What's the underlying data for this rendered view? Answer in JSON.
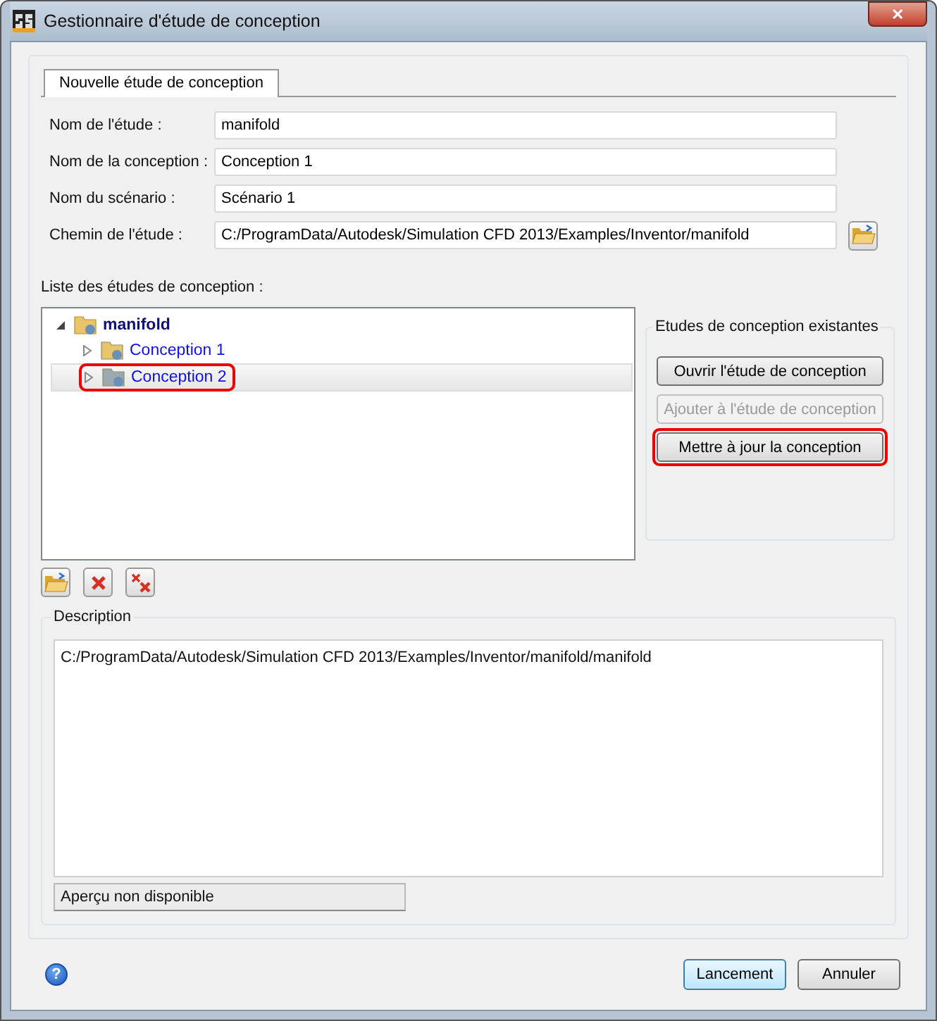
{
  "window": {
    "title": "Gestionnaire d'étude de conception",
    "close": "✕"
  },
  "tabs": [
    {
      "label": "Nouvelle étude de conception",
      "selected": true
    }
  ],
  "fields": [
    {
      "label": "Nom de l'étude :",
      "value": "manifold"
    },
    {
      "label": "Nom de la conception :",
      "value": "Conception 1"
    },
    {
      "label": "Nom du scénario :",
      "value": "Scénario 1"
    },
    {
      "label": "Chemin de l'étude :",
      "value": "C:/ProgramData/Autodesk/Simulation CFD 2013/Examples/Inventor/manifold",
      "browse": true
    }
  ],
  "tree": {
    "label": "Liste des études de conception :",
    "items": [
      {
        "label": "manifold",
        "expanded": true,
        "selected": false,
        "highlighted": false,
        "children": [
          {
            "label": "Conception 1",
            "expanded": false,
            "selected": false,
            "highlighted": false
          },
          {
            "label": "Conception 2",
            "expanded": false,
            "selected": true,
            "highlighted": true
          }
        ]
      }
    ]
  },
  "existing": {
    "title": "Etudes de conception existantes",
    "buttons": [
      {
        "label": "Ouvrir l'étude de conception",
        "disabled": false,
        "highlighted": false
      },
      {
        "label": "Ajouter à l'étude de conception",
        "disabled": true,
        "highlighted": false
      },
      {
        "label": "Mettre à jour la conception",
        "disabled": false,
        "highlighted": true
      }
    ]
  },
  "tools": [
    {
      "kind": "open"
    },
    {
      "kind": "delete"
    },
    {
      "kind": "delete-all"
    }
  ],
  "description": {
    "title": "Description",
    "text": "C:/ProgramData/Autodesk/Simulation CFD 2013/Examples/Inventor/manifold/manifold",
    "preview": "Aperçu non disponible"
  },
  "footer": {
    "help": "?",
    "buttons": [
      {
        "label": "Lancement",
        "default": true
      },
      {
        "label": "Annuler",
        "default": false
      }
    ]
  }
}
